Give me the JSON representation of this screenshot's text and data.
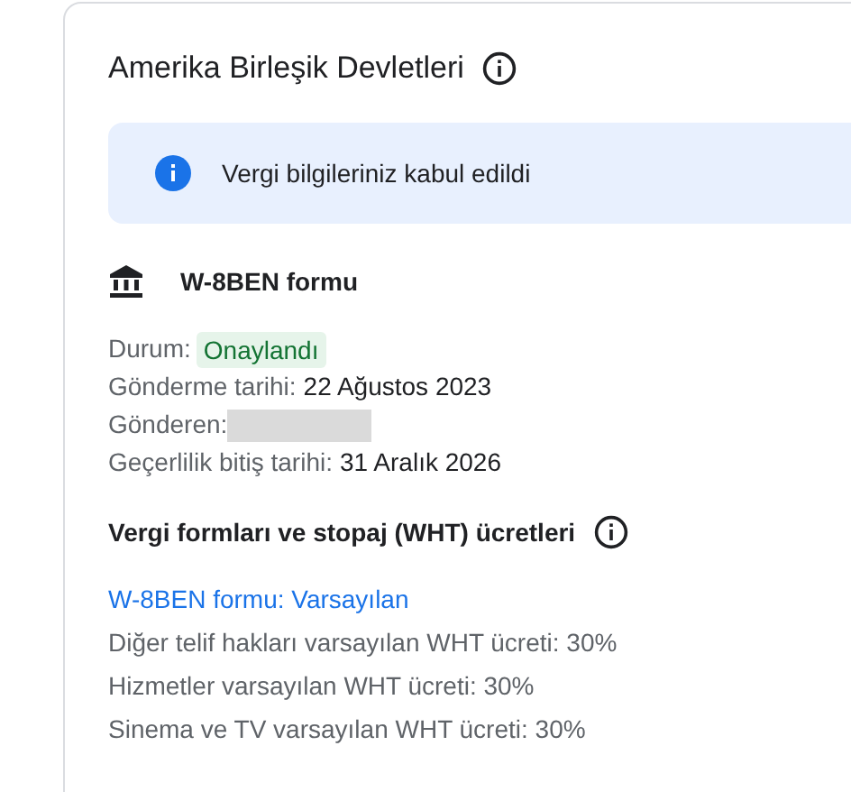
{
  "title": "Amerika Birleşik Devletleri",
  "banner": {
    "text": "Vergi bilgileriniz kabul edildi"
  },
  "form": {
    "name": "W-8BEN formu"
  },
  "details": [
    {
      "kind": "status",
      "label": "Durum:",
      "value": "Onaylandı"
    },
    {
      "kind": "text",
      "label": "Gönderme tarihi:",
      "value": "22 Ağustos 2023"
    },
    {
      "kind": "redacted",
      "label": "Gönderen:"
    },
    {
      "kind": "text",
      "label": "Geçerlilik bitiş tarihi:",
      "value": "31 Aralık 2026"
    }
  ],
  "rates": {
    "heading": "Vergi formları ve stopaj (WHT) ücretleri",
    "link": "W-8BEN formu: Varsayılan",
    "items": [
      "Diğer telif hakları varsayılan WHT ücreti: 30%",
      "Hizmetler varsayılan WHT ücreti: 30%",
      "Sinema ve TV varsayılan WHT ücreti: 30%"
    ]
  }
}
